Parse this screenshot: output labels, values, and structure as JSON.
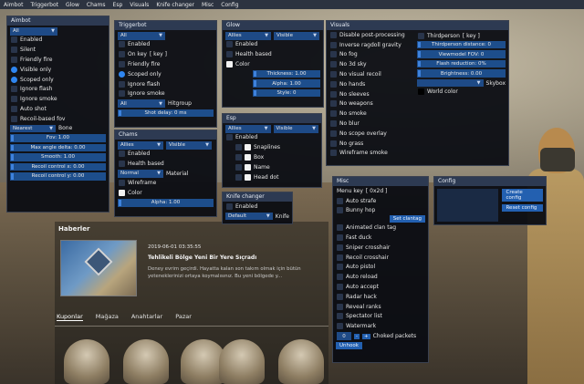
{
  "menubar": [
    "Aimbot",
    "Triggerbot",
    "Glow",
    "Chams",
    "Esp",
    "Visuals",
    "Knife changer",
    "Misc",
    "Config"
  ],
  "aimbot": {
    "title": "Aimbot",
    "select": "All",
    "checks": [
      {
        "label": "Enabled",
        "on": false
      },
      {
        "label": "Silent",
        "on": false
      },
      {
        "label": "Friendly fire",
        "on": false
      },
      {
        "label": "Visible only",
        "on": true
      },
      {
        "label": "Scoped only",
        "on": true
      },
      {
        "label": "Ignore flash",
        "on": false
      },
      {
        "label": "Ignore smoke",
        "on": false
      },
      {
        "label": "Auto shot",
        "on": false
      },
      {
        "label": "Recoil-based fov",
        "on": false
      }
    ],
    "target": "Nearest",
    "bone": "Bone",
    "sliders": [
      "Fov: 1.00",
      "Max angle delta: 0.00",
      "Smooth: 1.00",
      "Recoil control x: 0.00",
      "Recoil control y: 0.00"
    ]
  },
  "triggerbot": {
    "title": "Triggerbot",
    "select": "All",
    "checks": [
      {
        "label": "Enabled",
        "on": false
      },
      {
        "label": "On key",
        "on": false
      },
      {
        "label": "Friendly fire",
        "on": false
      },
      {
        "label": "Scoped only",
        "on": true
      },
      {
        "label": "Ignore flash",
        "on": false
      },
      {
        "label": "Ignore smoke",
        "on": false
      }
    ],
    "key": "[ key ]",
    "hitgroup_select": "All",
    "hitgroup_label": "Hitgroup",
    "shot_delay": "Shot delay: 0 ms"
  },
  "glow": {
    "title": "Glow",
    "select1": "Allies",
    "select2": "Visible",
    "checks": [
      "Enabled",
      "Health based",
      "Color"
    ],
    "sliders": [
      "Thickness: 1.00",
      "Alpha: 1.00",
      "Style: 0"
    ]
  },
  "chams": {
    "title": "Chams",
    "select1": "Allies",
    "select2": "Visible",
    "checks": [
      "Enabled",
      "Health based"
    ],
    "material_select": "Normal",
    "material_label": "Material",
    "checks2": [
      "Wireframe",
      "Color"
    ],
    "alpha": "Alpha: 1.00"
  },
  "esp": {
    "title": "Esp",
    "select1": "Allies",
    "select2": "Visible",
    "enabled": "Enabled",
    "items": [
      "Snaplines",
      "Box",
      "Name",
      "Head dot"
    ]
  },
  "knife": {
    "title": "Knife changer",
    "enabled": "Enabled",
    "select": "Default",
    "label": "Knife"
  },
  "visuals": {
    "title": "Visuals",
    "checks": [
      "Disable post-processing",
      "Inverse ragdoll gravity",
      "No fog",
      "No 3d sky",
      "No visual recoil",
      "No hands",
      "No sleeves",
      "No weapons",
      "No smoke",
      "No blur",
      "No scope overlay",
      "No grass",
      "Wireframe smoke"
    ],
    "thirdperson": "Thirdperson",
    "thirdperson_key": "[ key ]",
    "sliders": [
      "Thirdperson distance: 0",
      "Viewmodel FOV: 0",
      "Flash reduction: 0%",
      "Brightness: 0.00"
    ],
    "skybox_select": "",
    "skybox_label": "Skybox",
    "world_color": "World color"
  },
  "misc": {
    "title": "Misc",
    "menu_key": "Menu key",
    "menu_key_val": "[ 0x2d ]",
    "checks": [
      "Auto strafe",
      "Bunny hop"
    ],
    "clantag_btn": "Set clantag",
    "checks2": [
      "Animated clan tag",
      "Fast duck",
      "Sniper crosshair",
      "Recoil crosshair",
      "Auto pistol",
      "Auto reload",
      "Auto accept",
      "Radar hack",
      "Reveal ranks",
      "Spectator list",
      "Watermark"
    ],
    "choked": "Choked packets",
    "choked_val": "0",
    "minus": "-",
    "plus": "+",
    "unhook": "Unhook"
  },
  "config": {
    "title": "Config",
    "create": "Create config",
    "reset": "Reset config"
  },
  "news": {
    "section": "Haberler",
    "date": "2019-06-01 03:35:55",
    "headline": "Tehlikeli Bölge Yeni Bir Yere Sıçradı",
    "body": "Deney evrim geçirdi. Hayatta kalan son takım olmak için bütün yeteneklerinizi ortaya koymalısınız. Bu yeni bölgede y..."
  },
  "store_tabs": [
    "Kuponlar",
    "Mağaza",
    "Anahtarlar",
    "Pazar"
  ]
}
